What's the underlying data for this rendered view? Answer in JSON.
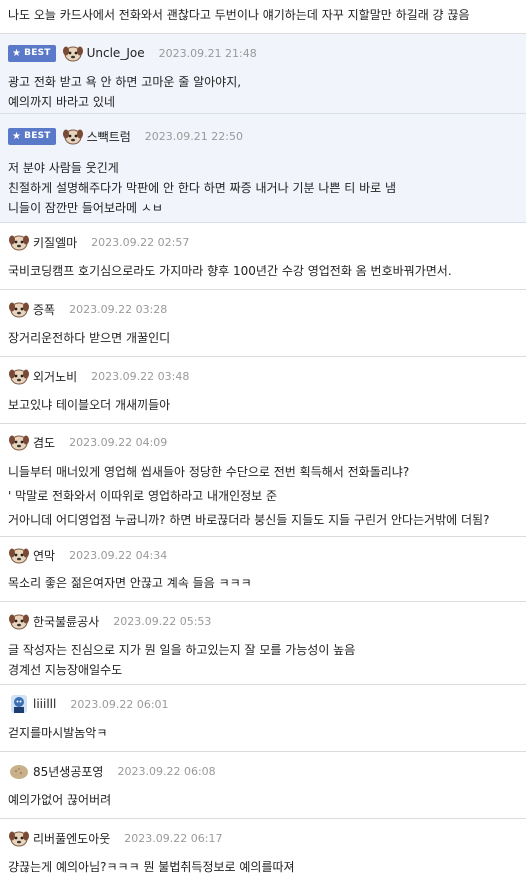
{
  "top_comment": "나도 오늘 카드사에서 전화와서 괜찮다고 두번이나 얘기하는데 자꾸 지할말만 하길래 걍 끊음",
  "best_label": "BEST",
  "colors": {
    "best_bg": "#f1f4fb",
    "badge": "#5a79c9",
    "date": "#9a9a9a"
  },
  "comments": [
    {
      "nick": "Uncle_Joe",
      "date": "2023.09.21 21:48",
      "avatar": "dog-avatar-icon",
      "lines": [
        "광고 전화 받고 욕 안 하면 고마운 줄 알아야지,",
        "예의까지 바라고 있네"
      ]
    },
    {
      "nick": "스빽트럼",
      "date": "2023.09.21 22:50",
      "avatar": "dog-avatar-icon",
      "lines": [
        "저 분야 사람들 웃긴게",
        "친절하게 설명해주다가 막판에 안 한다 하면 짜증 내거나 기분 나쁜 티 바로 냄",
        "니들이 잠깐만 들어보라메 ㅅㅂ"
      ]
    },
    {
      "nick": "키질엘마",
      "date": "2023.09.22 02:57",
      "avatar": "dog-avatar-icon",
      "lines": [
        "국비코딩캠프 호기심으로라도 가지마라 향후 100년간 수강 영업전화 옴 번호바꿔가면서."
      ]
    },
    {
      "nick": "증폭",
      "date": "2023.09.22 03:28",
      "avatar": "dog-avatar-icon",
      "lines": [
        "장거리운전하다 받으면 개꿀인디"
      ]
    },
    {
      "nick": "외거노비",
      "date": "2023.09.22 03:48",
      "avatar": "dog-avatar-icon",
      "lines": [
        "보고있냐 테이블오더 개새끼들아"
      ]
    },
    {
      "nick": "겸도",
      "date": "2023.09.22 04:09",
      "avatar": "dog-avatar-icon",
      "lines": [
        "니들부터 매너있게 영업해 씹새들아 정당한 수단으로 전번 획득해서 전화돌리냐?",
        "' 막말로 전화와서 이따위로 영업하라고 내개인정보 준",
        "거아니데 어디영업점 누굽니까? 하면 바로끊더라 붕신들 지들도 지들 구린거 안다는거밖에 더됨?"
      ]
    },
    {
      "nick": "연막",
      "date": "2023.09.22 04:34",
      "avatar": "dog-avatar-icon",
      "lines": [
        "목소리 좋은 젊은여자면 안끊고 계속 들음 ㅋㅋㅋ"
      ]
    },
    {
      "nick": "한국불륜공사",
      "date": "2023.09.22 05:53",
      "avatar": "dog-avatar-icon",
      "lines": [
        "글 작성자는 진심으로 지가 뭔 일을 하고있는지 잘 모를 가능성이 높음",
        "경계선 지능장애일수도"
      ]
    },
    {
      "nick": "liiilll",
      "date": "2023.09.22 06:01",
      "avatar": "character-avatar-icon",
      "lines": [
        "걷지를마시발놈악ㅋ"
      ]
    },
    {
      "nick": "85년생공포영",
      "date": "2023.09.22 06:08",
      "avatar": "potato-avatar-icon",
      "lines": [
        "예의가없어 끊어버려"
      ]
    },
    {
      "nick": "리버풀엔도아웃",
      "date": "2023.09.22 06:17",
      "avatar": "dog-avatar-icon",
      "lines": [
        "걍끊는게 예의아님?ㅋㅋㅋ 뭔 불법취득정보로 예의를따져"
      ]
    }
  ]
}
